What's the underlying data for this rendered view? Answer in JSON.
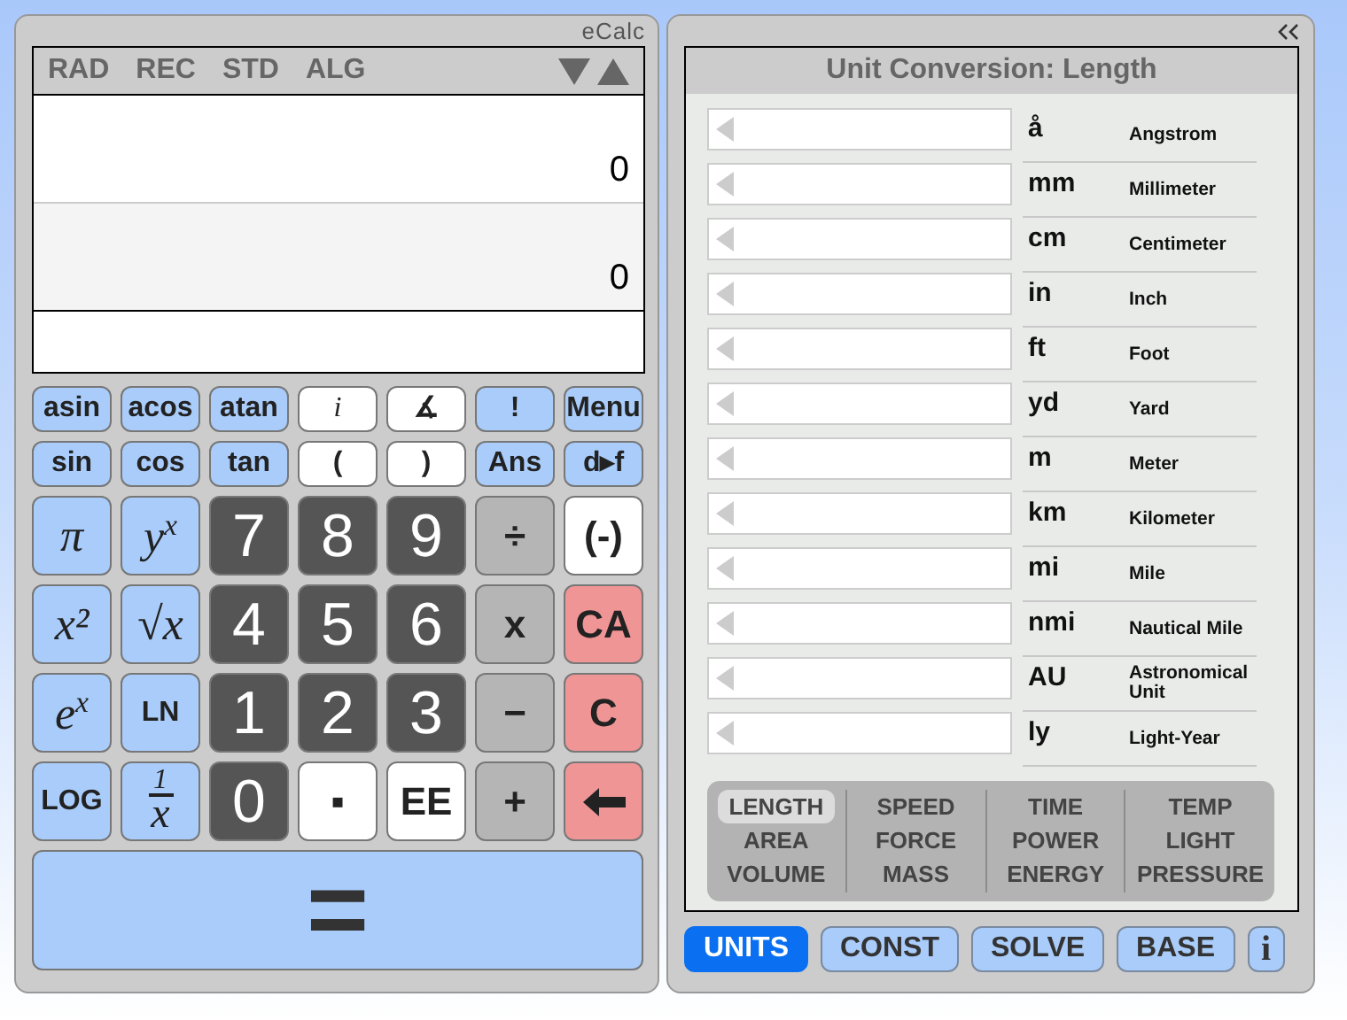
{
  "calculator": {
    "brand": "eCalc",
    "modes": [
      {
        "label": "RAD"
      },
      {
        "label": "REC"
      },
      {
        "label": "STD"
      },
      {
        "label": "ALG"
      }
    ],
    "display": {
      "history": "0",
      "result": "0"
    },
    "function_keys": [
      {
        "label": "asin",
        "kind": "function"
      },
      {
        "label": "acos",
        "kind": "function"
      },
      {
        "label": "atan",
        "kind": "function"
      },
      {
        "label": "i",
        "kind": "white",
        "italic": true
      },
      {
        "label": "∡",
        "kind": "white"
      },
      {
        "label": "!",
        "kind": "function"
      },
      {
        "label": "Menu",
        "kind": "function"
      },
      {
        "label": "sin",
        "kind": "function"
      },
      {
        "label": "cos",
        "kind": "function"
      },
      {
        "label": "tan",
        "kind": "function"
      },
      {
        "label": "(",
        "kind": "white"
      },
      {
        "label": ")",
        "kind": "white"
      },
      {
        "label": "Ans",
        "kind": "function"
      },
      {
        "label": "d▸f",
        "kind": "function"
      }
    ],
    "main_keys": [
      {
        "label": "π",
        "kind": "function",
        "italic": true
      },
      {
        "label": "y$^{x}$",
        "kind": "function",
        "italic": true
      },
      {
        "label": "7",
        "kind": "digit"
      },
      {
        "label": "8",
        "kind": "digit"
      },
      {
        "label": "9",
        "kind": "digit"
      },
      {
        "label": "÷",
        "kind": "operator"
      },
      {
        "label": "(-)",
        "kind": "white"
      },
      {
        "label": "x²",
        "kind": "function",
        "italic": true
      },
      {
        "label": "√x",
        "kind": "function",
        "italic": true
      },
      {
        "label": "4",
        "kind": "digit"
      },
      {
        "label": "5",
        "kind": "digit"
      },
      {
        "label": "6",
        "kind": "digit"
      },
      {
        "label": "x",
        "kind": "operator"
      },
      {
        "label": "CA",
        "kind": "clear"
      },
      {
        "label": "e$^{x}$",
        "kind": "function",
        "italic": true
      },
      {
        "label": "LN",
        "kind": "function"
      },
      {
        "label": "1",
        "kind": "digit"
      },
      {
        "label": "2",
        "kind": "digit"
      },
      {
        "label": "3",
        "kind": "digit"
      },
      {
        "label": "−",
        "kind": "operator"
      },
      {
        "label": "C",
        "kind": "clear"
      },
      {
        "label": "LOG",
        "kind": "function"
      },
      {
        "numerator": "1",
        "denominator": "x",
        "kind": "function",
        "italic": true
      },
      {
        "label": "0",
        "kind": "digit"
      },
      {
        "label": "▪",
        "kind": "white"
      },
      {
        "label": "EE",
        "kind": "white"
      },
      {
        "label": "+",
        "kind": "operator"
      },
      {
        "kind": "clear"
      }
    ],
    "equals": "="
  },
  "converter": {
    "title": "Unit Conversion: Length",
    "units": [
      {
        "symbol": "å",
        "name": "Angstrom"
      },
      {
        "symbol": "mm",
        "name": "Millimeter"
      },
      {
        "symbol": "cm",
        "name": "Centimeter"
      },
      {
        "symbol": "in",
        "name": "Inch"
      },
      {
        "symbol": "ft",
        "name": "Foot"
      },
      {
        "symbol": "yd",
        "name": "Yard"
      },
      {
        "symbol": "m",
        "name": "Meter"
      },
      {
        "symbol": "km",
        "name": "Kilometer"
      },
      {
        "symbol": "mi",
        "name": "Mile"
      },
      {
        "symbol": "nmi",
        "name": "Nautical Mile"
      },
      {
        "symbol": "AU",
        "name": "Astronomical Unit"
      },
      {
        "symbol": "ly",
        "name": "Light-Year"
      }
    ],
    "categories": [
      [
        {
          "label": "LENGTH",
          "selected": true
        },
        {
          "label": "AREA",
          "selected": false
        },
        {
          "label": "VOLUME",
          "selected": false
        }
      ],
      [
        {
          "label": "SPEED",
          "selected": false
        },
        {
          "label": "FORCE",
          "selected": false
        },
        {
          "label": "MASS",
          "selected": false
        }
      ],
      [
        {
          "label": "TIME",
          "selected": false
        },
        {
          "label": "POWER",
          "selected": false
        },
        {
          "label": "ENERGY",
          "selected": false
        }
      ],
      [
        {
          "label": "TEMP",
          "selected": false
        },
        {
          "label": "LIGHT",
          "selected": false
        },
        {
          "label": "PRESSURE",
          "selected": false
        }
      ]
    ]
  },
  "tabs": [
    {
      "label": "UNITS",
      "selected": true
    },
    {
      "label": "CONST",
      "selected": false
    },
    {
      "label": "SOLVE",
      "selected": false
    },
    {
      "label": "BASE",
      "selected": false
    },
    {
      "label": "i",
      "selected": false
    }
  ]
}
